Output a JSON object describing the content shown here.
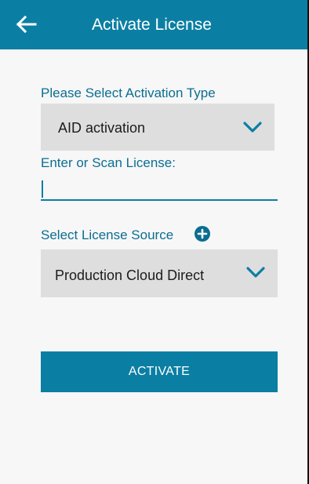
{
  "app_bar": {
    "title": "Activate License",
    "back_icon": "arrow-left-icon",
    "background": "#0b7fa3"
  },
  "activation_type": {
    "label": "Please Select Activation Type",
    "selected": "AID activation",
    "chevron_icon": "chevron-down-icon"
  },
  "license": {
    "label": "Enter or Scan License:",
    "value": "",
    "placeholder": ""
  },
  "license_source": {
    "label": "Select License Source",
    "add_icon": "plus-circle-icon",
    "selected": "Production Cloud Direct",
    "chevron_icon": "chevron-down-icon"
  },
  "actions": {
    "activate_label": "ACTIVATE"
  },
  "colors": {
    "accent": "#0b7fa3",
    "label_text": "#0b6e91",
    "field_background": "#dedede",
    "page_background": "#f7f7f7"
  }
}
